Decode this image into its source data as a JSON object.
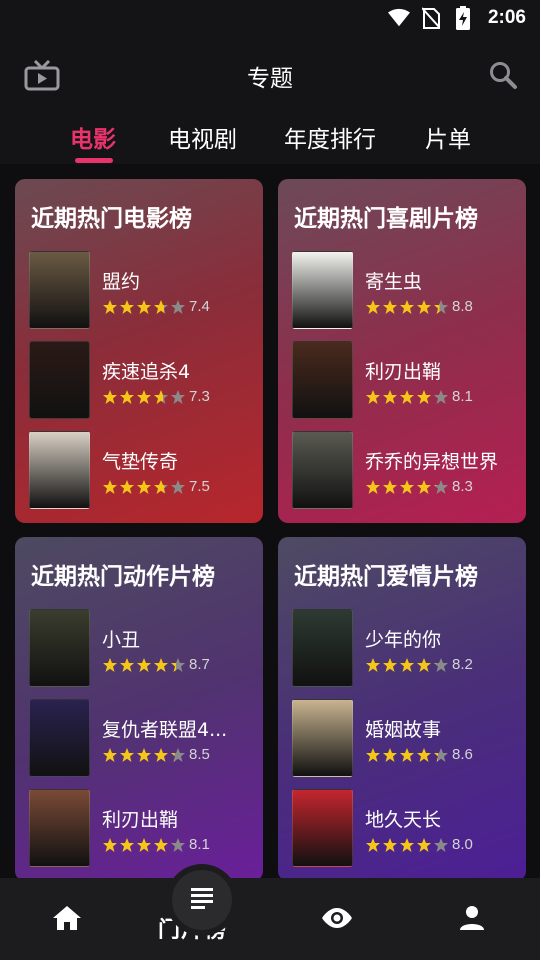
{
  "status_bar": {
    "time": "2:06"
  },
  "app_bar": {
    "title": "专题",
    "left_icon": "tv-icon",
    "right_icon": "search-icon"
  },
  "tabs": [
    {
      "label": "电影",
      "active": true
    },
    {
      "label": "电视剧",
      "active": false
    },
    {
      "label": "年度排行",
      "active": false
    },
    {
      "label": "片单",
      "active": false
    }
  ],
  "colors": {
    "accent": "#e8336d",
    "star": "#f5c518",
    "star_empty": "#8a8a8a"
  },
  "cards": [
    {
      "title": "近期热门电影榜",
      "items": [
        {
          "title": "盟约",
          "rating": "7.4",
          "stars": 3.7
        },
        {
          "title": "疾速追杀4",
          "rating": "7.3",
          "stars": 3.65
        },
        {
          "title": "气垫传奇",
          "rating": "7.5",
          "stars": 3.75
        }
      ]
    },
    {
      "title": "近期热门喜剧片榜",
      "items": [
        {
          "title": "寄生虫",
          "rating": "8.8",
          "stars": 4.4
        },
        {
          "title": "利刃出鞘",
          "rating": "8.1",
          "stars": 4.05
        },
        {
          "title": "乔乔的异想世界",
          "rating": "8.3",
          "stars": 4.15
        }
      ]
    },
    {
      "title": "近期热门动作片榜",
      "items": [
        {
          "title": "小丑",
          "rating": "8.7",
          "stars": 4.35
        },
        {
          "title": "复仇者联盟4...",
          "rating": "8.5",
          "stars": 4.25
        },
        {
          "title": "利刃出鞘",
          "rating": "8.1",
          "stars": 4.05
        }
      ]
    },
    {
      "title": "近期热门爱情片榜",
      "items": [
        {
          "title": "少年的你",
          "rating": "8.2",
          "stars": 4.1
        },
        {
          "title": "婚姻故事",
          "rating": "8.6",
          "stars": 4.3
        },
        {
          "title": "地久天长",
          "rating": "8.0",
          "stars": 4.0
        }
      ]
    }
  ],
  "bottom_nav": {
    "items": [
      "home-icon",
      "list-icon",
      "eye-icon",
      "person-icon"
    ],
    "notch_label": "门片榜"
  }
}
